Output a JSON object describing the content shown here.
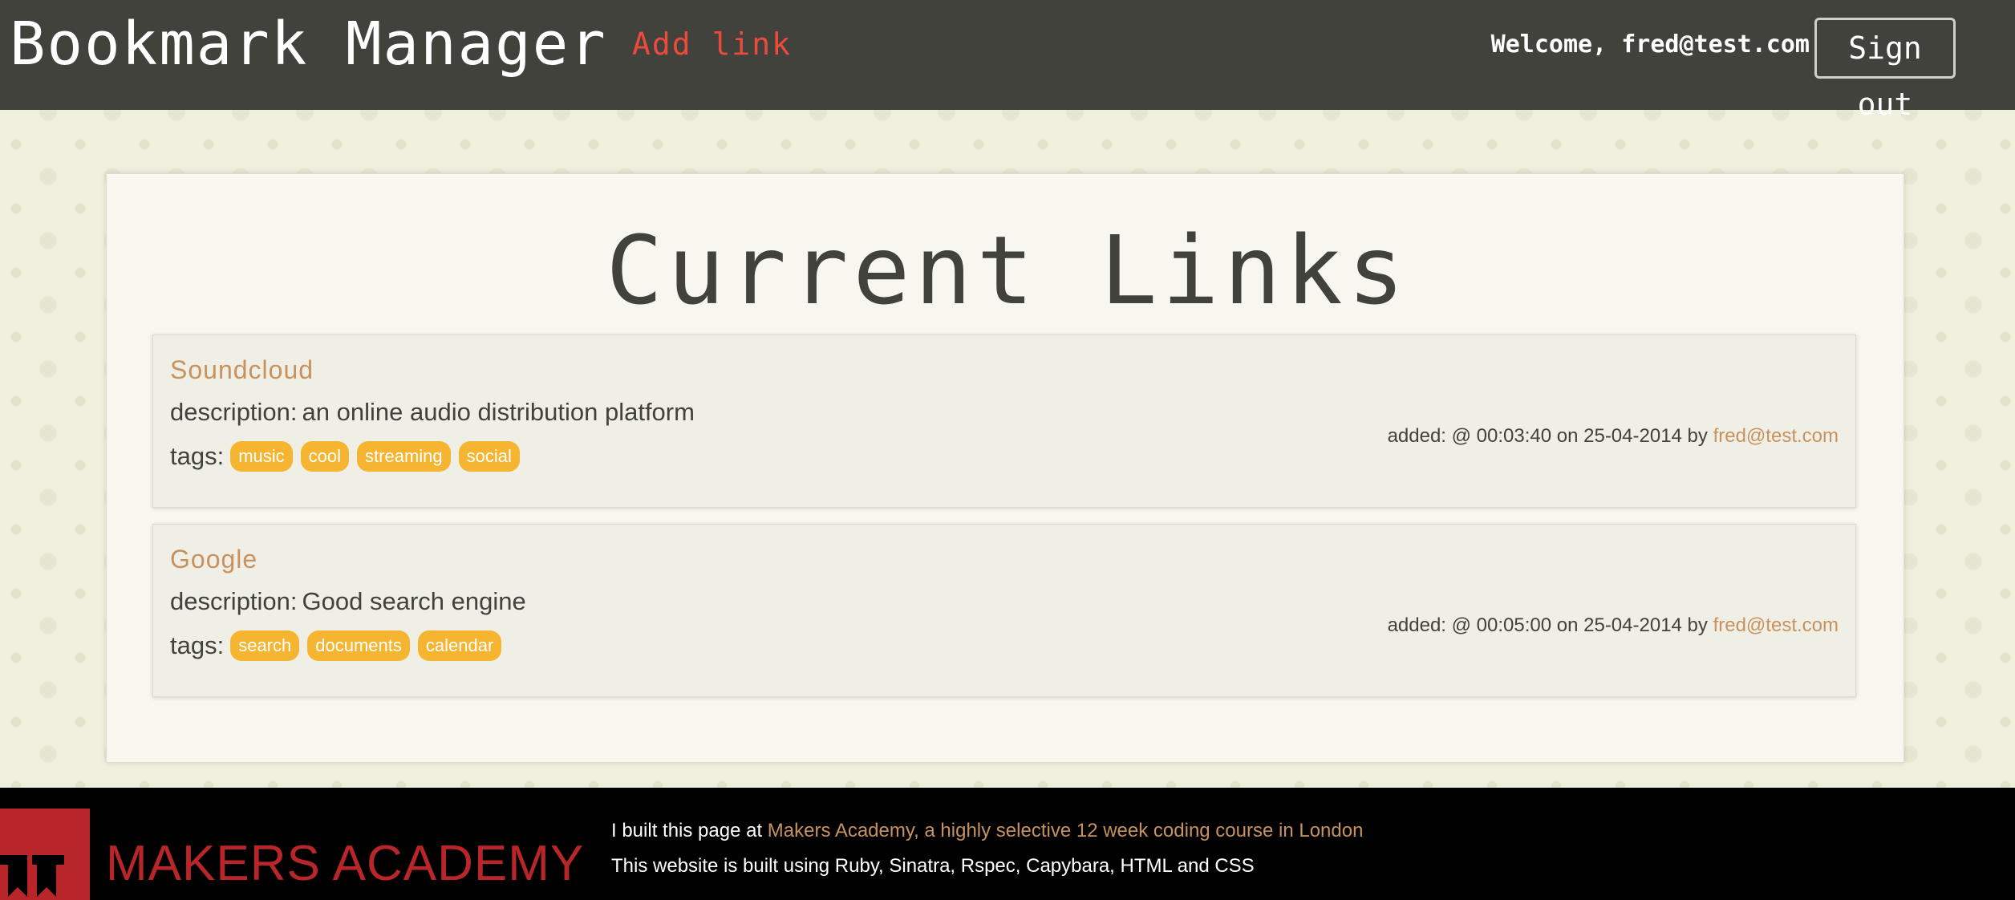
{
  "header": {
    "app_title": "Bookmark Manager",
    "add_link_label": "Add link",
    "welcome_text": "Welcome, fred@test.com",
    "signout_label": "Sign out"
  },
  "main": {
    "page_title": "Current Links",
    "links": [
      {
        "title": "Soundcloud",
        "description_label": "description:",
        "description": "an online audio distribution platform",
        "tags_label": "tags:",
        "tags": [
          "music",
          "cool",
          "streaming",
          "social"
        ],
        "added_text": "added: @ 00:03:40 on 25-04-2014 by",
        "added_by": "fred@test.com"
      },
      {
        "title": "Google",
        "description_label": "description:",
        "description": "Good search engine",
        "tags_label": "tags:",
        "tags": [
          "search",
          "documents",
          "calendar"
        ],
        "added_text": "added: @ 00:05:00 on 25-04-2014 by",
        "added_by": "fred@test.com"
      }
    ]
  },
  "footer": {
    "brand": "MAKERS ACADEMY",
    "line1_prefix": "I built this page at",
    "line1_link": "Makers Academy, a highly selective 12 week coding course in London",
    "line2": "This website is built using Ruby, Sinatra, Rspec, Capybara, HTML and CSS"
  },
  "colors": {
    "header_bg": "#42423d",
    "accent_red": "#ee4a3c",
    "link_tan": "#c8925e",
    "tag_orange": "#f6b530",
    "brand_red": "#b8262a"
  },
  "icons": {
    "logo": "makers-academy-logo-icon"
  }
}
